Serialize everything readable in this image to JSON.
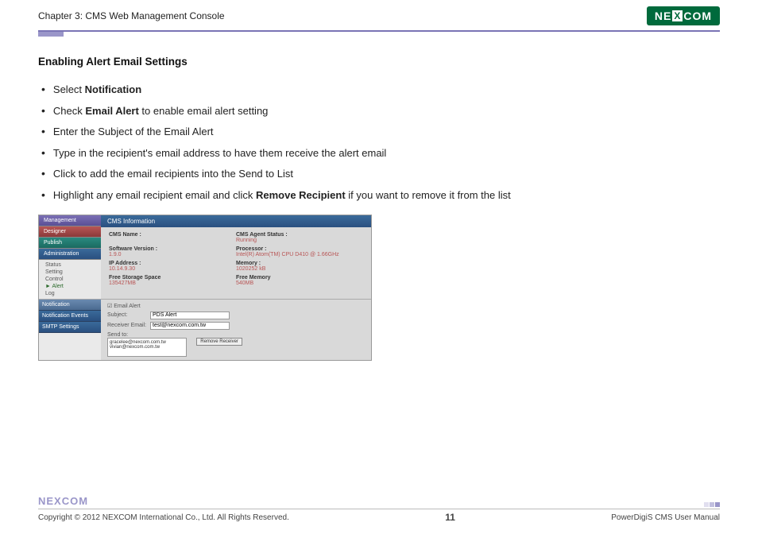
{
  "header": {
    "chapter": "Chapter 3: CMS Web Management Console",
    "logo_text": "NEXCOM"
  },
  "section": {
    "title": "Enabling Alert Email Settings",
    "bullets": {
      "b1_pre": "Select ",
      "b1_bold": "Notification",
      "b2_pre": "Check ",
      "b2_bold": "Email Alert",
      "b2_post": " to enable email alert setting",
      "b3": "Enter the Subject of the Email Alert",
      "b4": "Type in the recipient's email address to have them receive the alert email",
      "b5": "Click     to add the email recipients into the Send to List",
      "b6_pre": "Highlight any email recipient email and click ",
      "b6_bold": "Remove Recipient",
      "b6_post": " if you want to remove it from the list"
    }
  },
  "screenshot": {
    "sidebar": {
      "management": "Management",
      "designer": "Designer",
      "publish": "Publish",
      "administration": "Administration",
      "sub": {
        "status": "Status",
        "setting": "Setting",
        "control": "Control",
        "alert": "► Alert",
        "log": "Log"
      }
    },
    "main_title": "CMS Information",
    "info": {
      "cms_name_l": "CMS Name :",
      "cms_name_v": "",
      "agent_l": "CMS Agent Status :",
      "agent_v": "Running",
      "sw_l": "Software Version :",
      "sw_v": "1.9.0",
      "proc_l": "Processor :",
      "proc_v": "Intel(R) Atom(TM) CPU D410 @ 1.66GHz",
      "ip_l": "IP Address :",
      "ip_v": "10.14.9.30",
      "mem_l": "Memory :",
      "mem_v": "1020252 kB",
      "fss_l": "Free Storage Space",
      "fss_v": "135427MB",
      "fm_l": "Free Memory",
      "fm_v": "540MB"
    },
    "tabs": {
      "notif": "Notification",
      "events": "Notification Events",
      "smtp": "SMTP Settings"
    },
    "form": {
      "check": "Email Alert",
      "subject_l": "Subject:",
      "subject_v": "PDS Alert",
      "recv_l": "Receiver Email:",
      "recv_v": "test@nexcom.com.tw",
      "sendto_l": "Send to:",
      "list1": "gracelee@nexcom.com.tw",
      "list2": "vivian@nexcom.com.tw",
      "remove_btn": "Remove Receiver"
    }
  },
  "footer": {
    "logo": "NEXCOM",
    "copyright": "Copyright © 2012 NEXCOM International Co., Ltd. All Rights Reserved.",
    "page": "11",
    "manual": "PowerDigiS CMS User Manual"
  }
}
